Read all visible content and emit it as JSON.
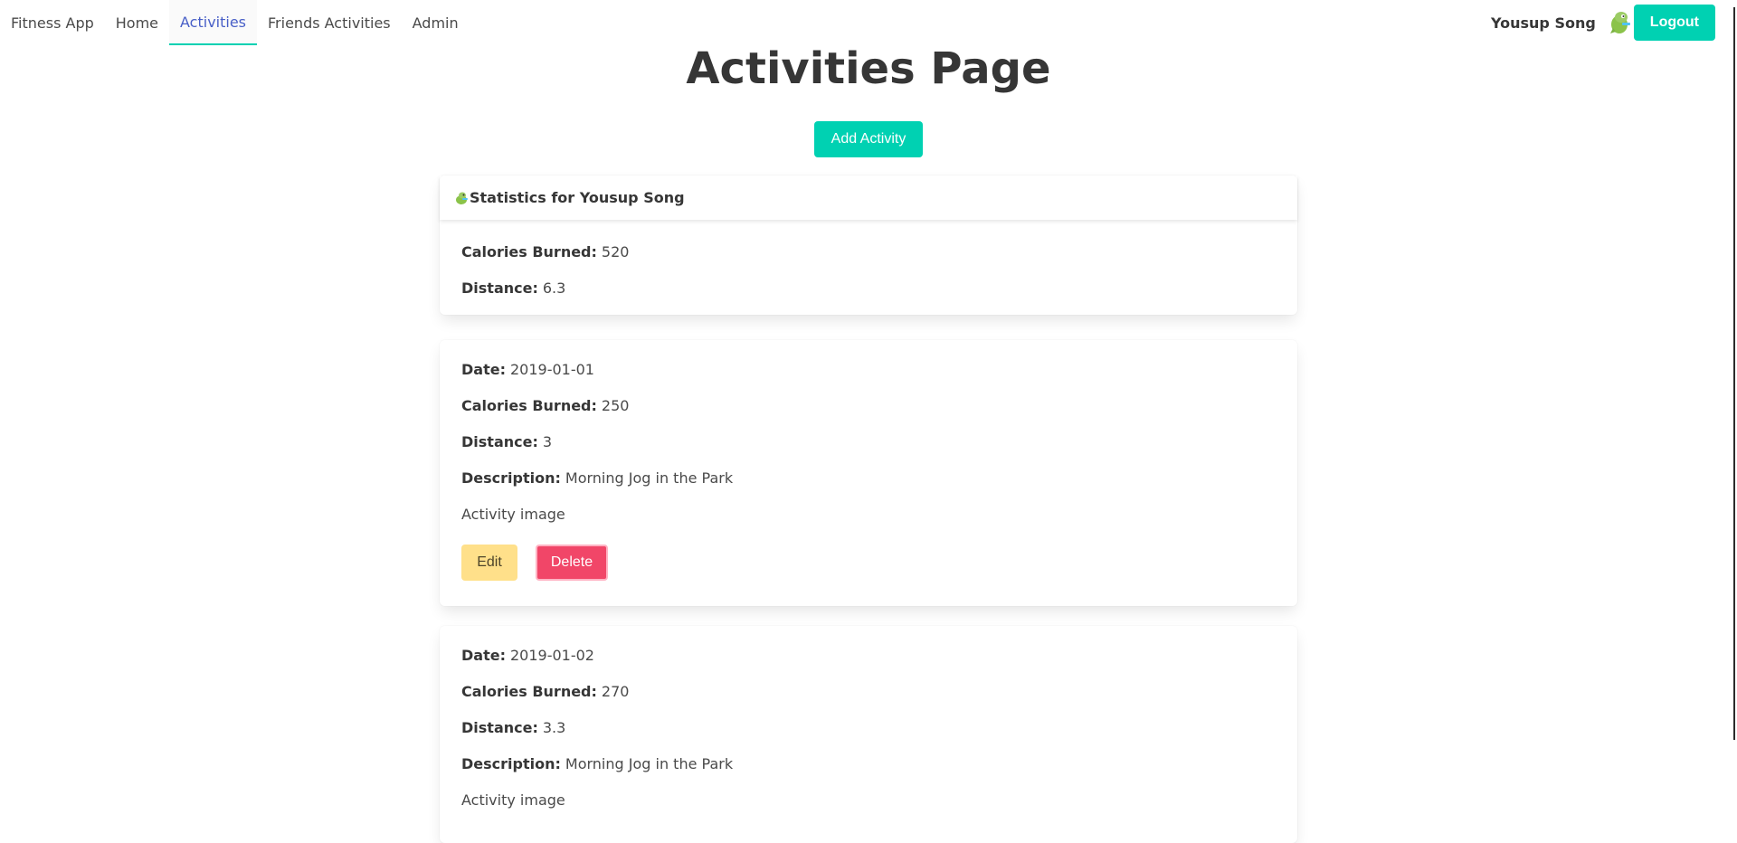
{
  "nav": {
    "brand": "Fitness App",
    "items": [
      {
        "label": "Home"
      },
      {
        "label": "Activities"
      },
      {
        "label": "Friends Activities"
      },
      {
        "label": "Admin"
      }
    ],
    "username": "Yousup Song",
    "logout_label": "Logout",
    "avatar_icon": "dinosaur-icon"
  },
  "page": {
    "title": "Activities Page",
    "add_button": "Add Activity"
  },
  "stats": {
    "header": "Statistics for Yousup Song",
    "header_icon": "dinosaur-icon",
    "calories_label": "Calories Burned:",
    "calories_value": "520",
    "distance_label": "Distance:",
    "distance_value": "6.3"
  },
  "activities": [
    {
      "date_label": "Date:",
      "date": "2019-01-01",
      "calories_label": "Calories Burned:",
      "calories": "250",
      "distance_label": "Distance:",
      "distance": "3",
      "description_label": "Description:",
      "description": "Morning Jog in the Park",
      "image_alt": "Activity image",
      "edit_label": "Edit",
      "delete_label": "Delete"
    },
    {
      "date_label": "Date:",
      "date": "2019-01-02",
      "calories_label": "Calories Burned:",
      "calories": "270",
      "distance_label": "Distance:",
      "distance": "3.3",
      "description_label": "Description:",
      "description": "Morning Jog in the Park",
      "image_alt": "Activity image"
    }
  ],
  "colors": {
    "primary": "#00d1b2",
    "link": "#485fc7",
    "warning": "#ffe08a",
    "danger": "#f14668"
  }
}
